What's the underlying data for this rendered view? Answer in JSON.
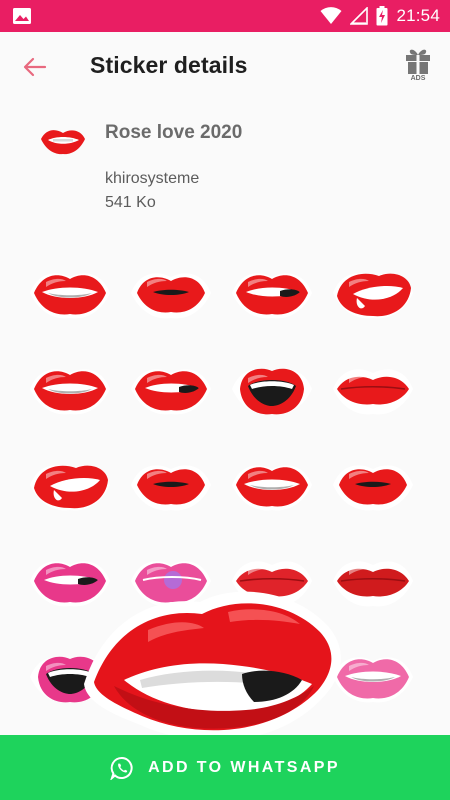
{
  "status_bar": {
    "time": "21:54",
    "background_color": "#e91e63",
    "icons": [
      "image-icon",
      "wifi-icon",
      "signal-icon",
      "battery-charging-icon"
    ]
  },
  "toolbar": {
    "title": "Sticker details",
    "back_icon": "arrow-left-icon",
    "ads_icon": "gift-icon",
    "ads_label": "ADS"
  },
  "pack": {
    "name": "Rose love 2020",
    "author": "khirosysteme",
    "size": "541 Ko"
  },
  "stickers": [
    {
      "style": "open-smile",
      "color": "#e8191b"
    },
    {
      "style": "pout",
      "color": "#e8191b"
    },
    {
      "style": "bite",
      "color": "#e8191b"
    },
    {
      "style": "side-smirk",
      "color": "#e8191b"
    },
    {
      "style": "open-smile",
      "color": "#e8191b"
    },
    {
      "style": "bite",
      "color": "#e8191b"
    },
    {
      "style": "wide-open",
      "color": "#e8191b"
    },
    {
      "style": "closed",
      "color": "#e8191b"
    },
    {
      "style": "tongue-side",
      "color": "#e8191b"
    },
    {
      "style": "pout",
      "color": "#e8191b"
    },
    {
      "style": "open-smile",
      "color": "#e8191b"
    },
    {
      "style": "kiss",
      "color": "#e8191b"
    },
    {
      "style": "bite",
      "color": "#e8388a"
    },
    {
      "style": "candy",
      "color": "#ea4d9a"
    },
    {
      "style": "closed",
      "color": "#e0232a"
    },
    {
      "style": "closed",
      "color": "#d01b1d"
    },
    {
      "style": "shout",
      "color": "#e8388a"
    },
    {
      "style": "pout",
      "color": "#e8191b"
    },
    {
      "style": "closed",
      "color": "#e8191b"
    },
    {
      "style": "open-smile",
      "color": "#f06aa8"
    }
  ],
  "add_button": {
    "label": "ADD TO WHATSAPP",
    "icon": "whatsapp-icon",
    "color": "#1ed35c"
  }
}
